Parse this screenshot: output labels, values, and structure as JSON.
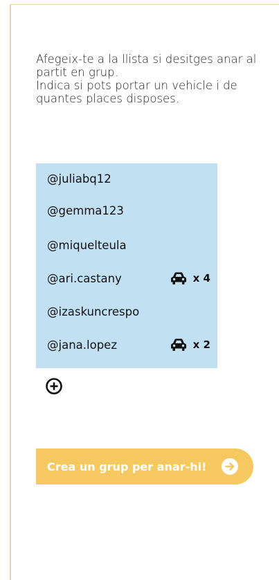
{
  "intro": {
    "line1": "Afegeix-te a la llista si desitges anar al partit en grup.",
    "line2": "Indica si pots portar un vehicle i de quantes places disposes."
  },
  "members": [
    {
      "handle": "@juliabq12",
      "car": ""
    },
    {
      "handle": "@gemma123",
      "car": ""
    },
    {
      "handle": "@miquelteula",
      "car": ""
    },
    {
      "handle": "@ari.castany",
      "car": "x 4"
    },
    {
      "handle": "@izaskuncrespo",
      "car": ""
    },
    {
      "handle": "@jana.lopez",
      "car": "x 2"
    }
  ],
  "icons": {
    "car": "car-icon",
    "add": "plus-circle-icon",
    "arrow": "arrow-right-circle-icon"
  },
  "cta": {
    "label": "Crea un grup per anar-hi!"
  },
  "colors": {
    "list_bg": "#c1e1f3",
    "cta_bg": "#f5c860",
    "frame": "#e3d6ad"
  }
}
